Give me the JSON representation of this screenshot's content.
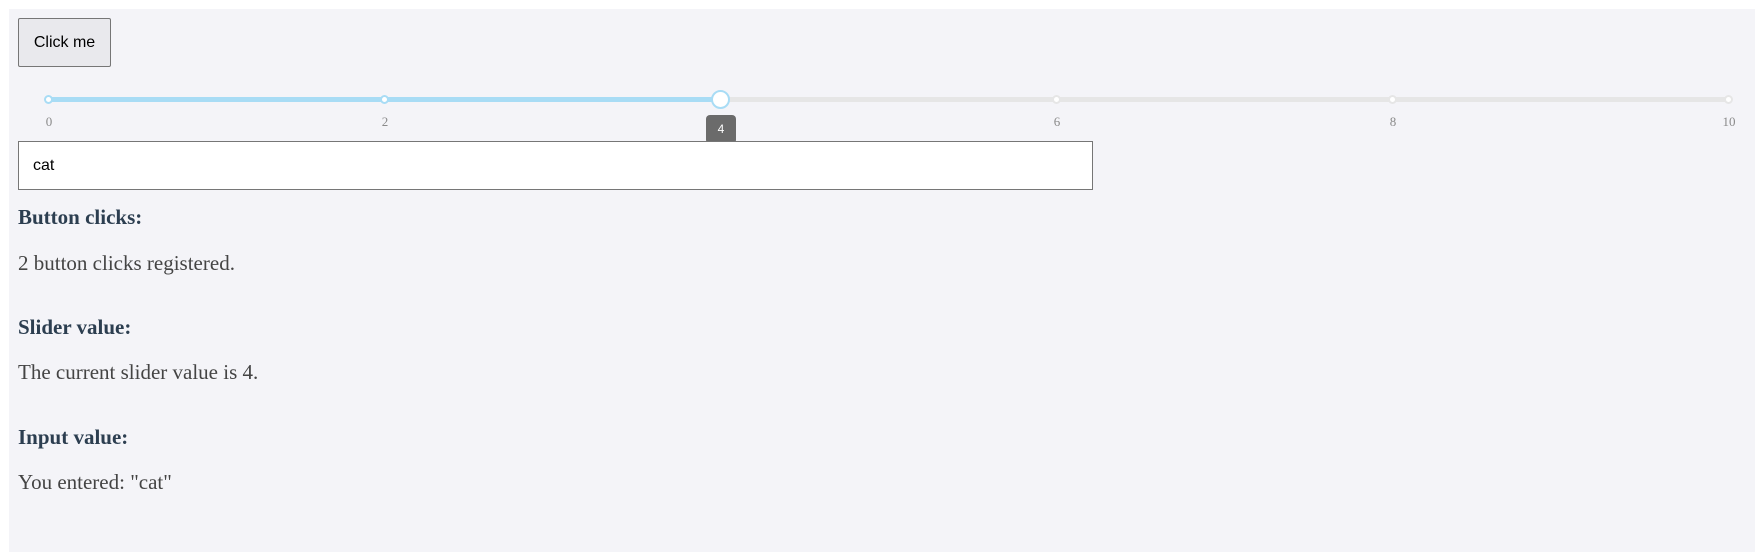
{
  "button": {
    "label": "Click me"
  },
  "slider": {
    "min": 0,
    "max": 10,
    "value": 4,
    "ticks": [
      "0",
      "2",
      "4",
      "6",
      "8",
      "10"
    ],
    "value_label": "4",
    "colors": {
      "active": "#a8dcf5",
      "inactive": "#e6e6e6",
      "bubble": "#6b6b6b"
    }
  },
  "input": {
    "value": "cat"
  },
  "sections": {
    "clicks": {
      "heading": "Button clicks:",
      "text": "2 button clicks registered."
    },
    "slider": {
      "heading": "Slider value:",
      "text": "The current slider value is 4."
    },
    "input": {
      "heading": "Input value:",
      "text": "You entered: \"cat\""
    }
  },
  "colors": {
    "background": "#f4f4f8",
    "heading": "#2c3e50",
    "body_text": "#444444"
  }
}
